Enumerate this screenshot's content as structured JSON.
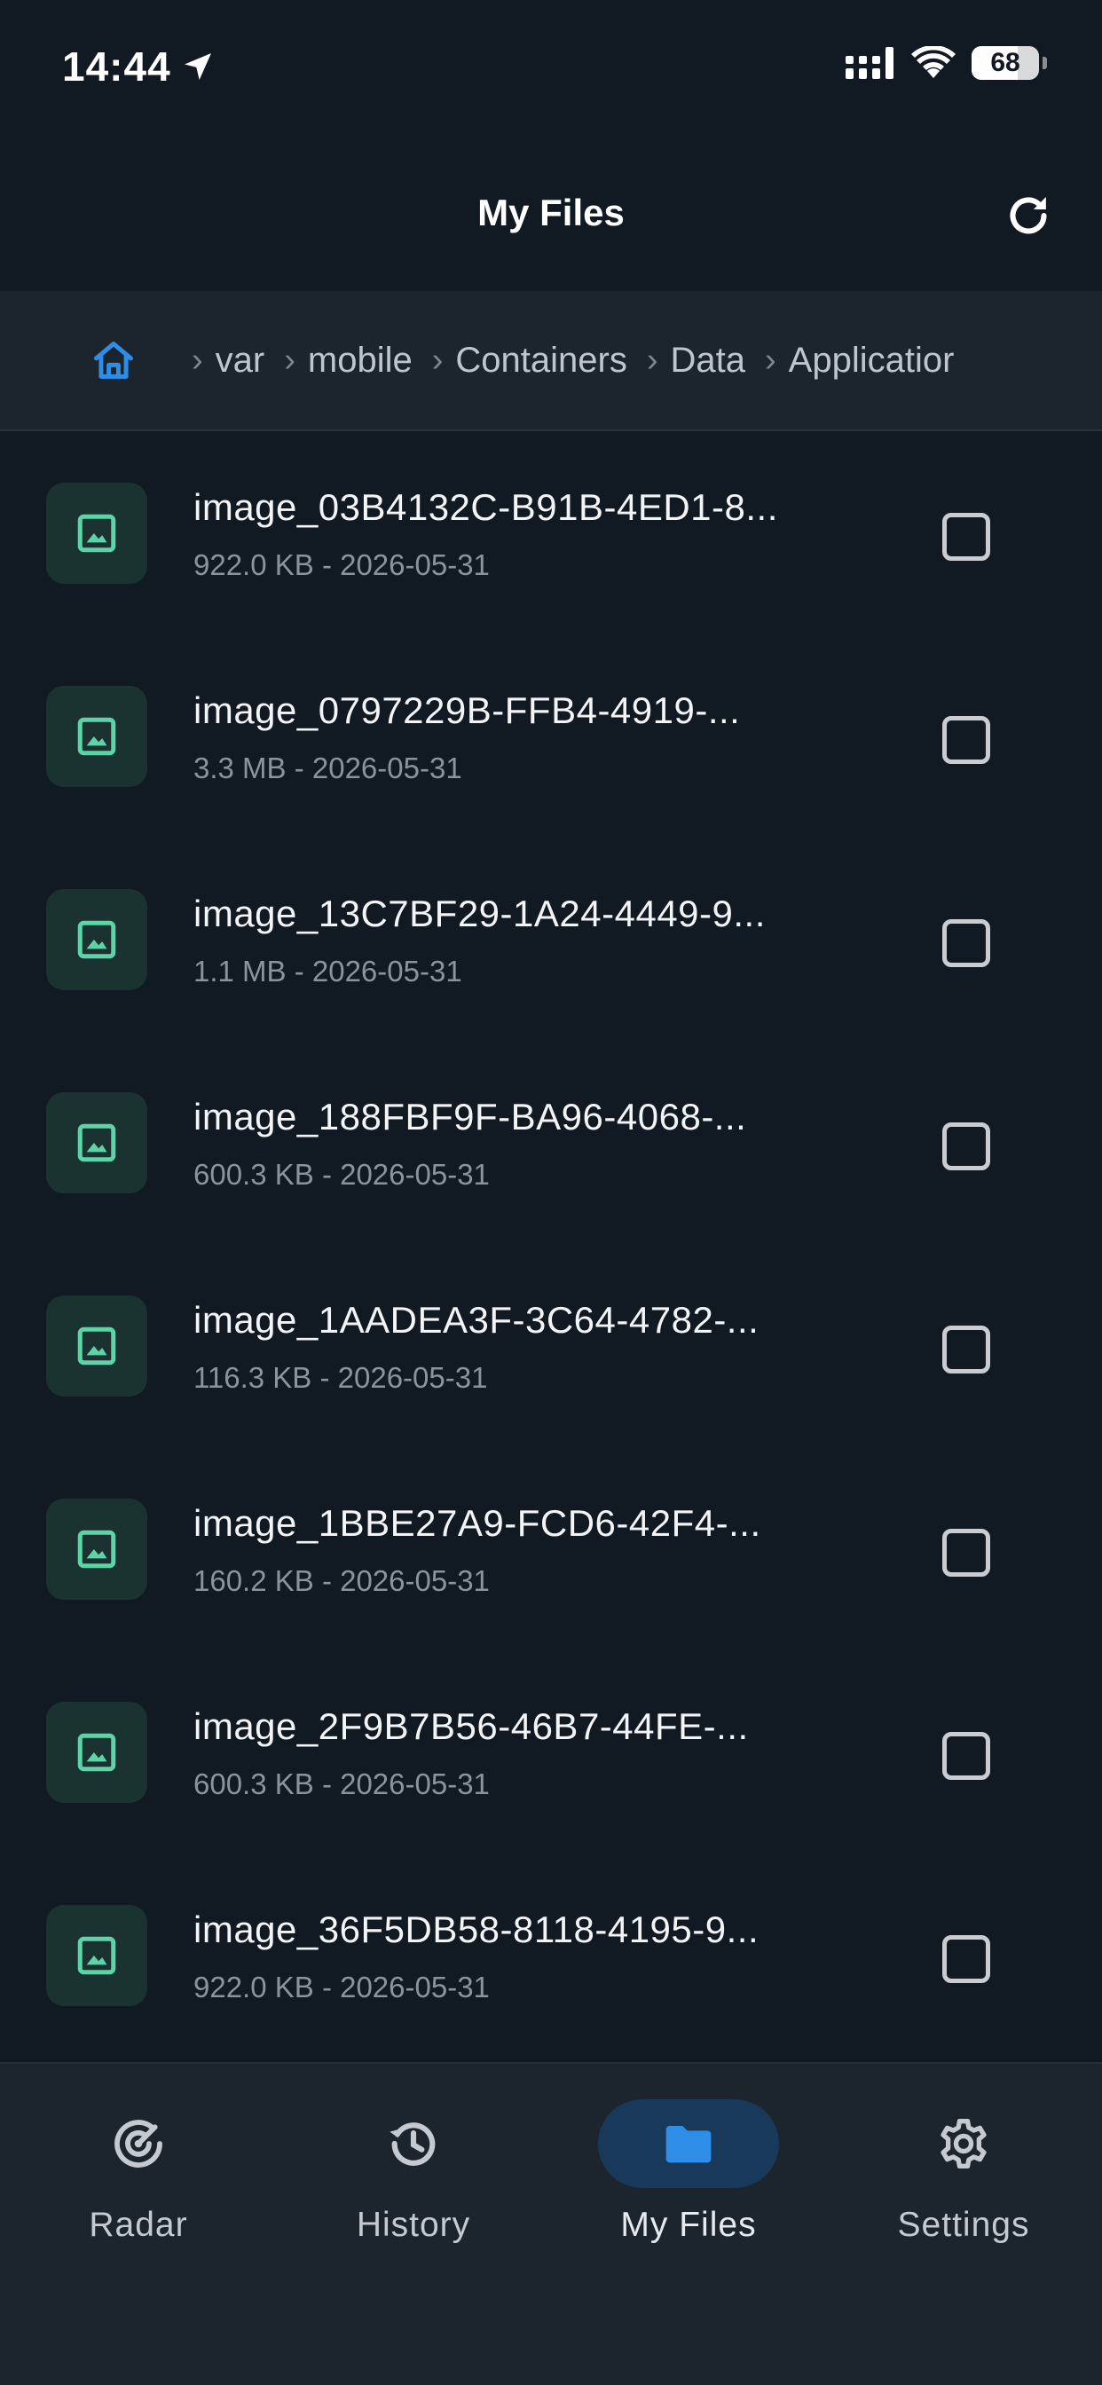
{
  "status_bar": {
    "time": "14:44",
    "battery": "68",
    "battery_level": 0.68
  },
  "header": {
    "title": "My Files"
  },
  "breadcrumb": {
    "items": [
      "var",
      "mobile",
      "Containers",
      "Data",
      "Applicatior"
    ]
  },
  "files": [
    {
      "name": "image_03B4132C-B91B-4ED1-8...",
      "meta": "922.0 KB - 2026-05-31"
    },
    {
      "name": "image_0797229B-FFB4-4919-...",
      "meta": "3.3 MB - 2026-05-31"
    },
    {
      "name": "image_13C7BF29-1A24-4449-9...",
      "meta": "1.1 MB - 2026-05-31"
    },
    {
      "name": "image_188FBF9F-BA96-4068-...",
      "meta": "600.3 KB - 2026-05-31"
    },
    {
      "name": "image_1AADEA3F-3C64-4782-...",
      "meta": "116.3 KB - 2026-05-31"
    },
    {
      "name": "image_1BBE27A9-FCD6-42F4-...",
      "meta": "160.2 KB - 2026-05-31"
    },
    {
      "name": "image_2F9B7B56-46B7-44FE-...",
      "meta": "600.3 KB - 2026-05-31"
    },
    {
      "name": "image_36F5DB58-8118-4195-9...",
      "meta": "922.0 KB - 2026-05-31"
    }
  ],
  "tabs": [
    {
      "label": "Radar",
      "icon": "radar-icon"
    },
    {
      "label": "History",
      "icon": "history-icon"
    },
    {
      "label": "My Files",
      "icon": "folder-icon",
      "active": true
    },
    {
      "label": "Settings",
      "icon": "gear-icon"
    }
  ],
  "colors": {
    "background": "#111922",
    "surface": "#1c242e",
    "accent": "#2e8de6",
    "thumb_icon": "#5ed3a7",
    "thumb_bg": "#1a3330"
  }
}
